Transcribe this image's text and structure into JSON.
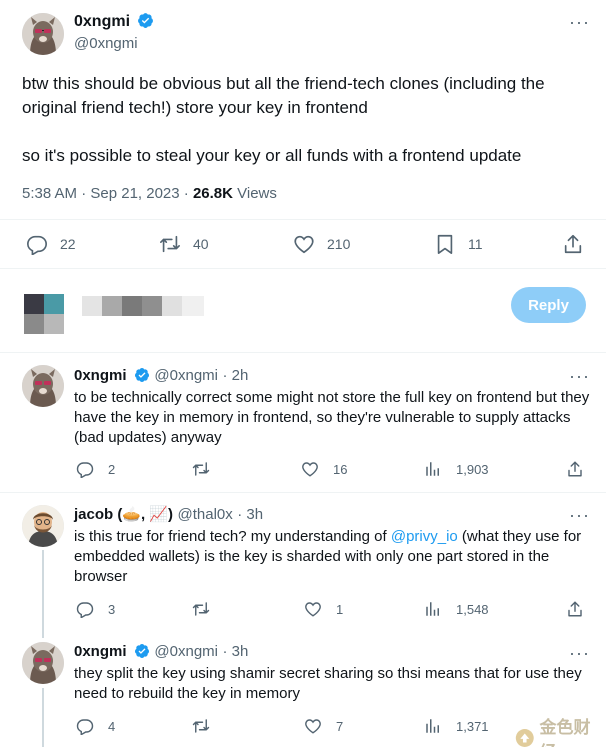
{
  "tweet": {
    "author_name": "0xngmi",
    "author_handle": "@0xngmi",
    "text_line1": "btw this should be obvious but all the friend-tech clones (including the original friend tech!) store your key in frontend",
    "text_line2": "so it's possible to steal your key or all funds with a frontend update",
    "time": "5:38 AM · Sep 21, 2023 · ",
    "views_count": "26.8K",
    "views_label": " Views",
    "replies": "22",
    "retweets": "40",
    "likes": "210",
    "bookmarks": "11"
  },
  "composer": {
    "reply_button": "Reply"
  },
  "replies": [
    {
      "name": "0xngmi",
      "handle": "@0xngmi",
      "time": "· 2h",
      "text": "to be technically correct some might not store the full key on frontend but they have the key in memory in frontend, so they're vulnerable to supply attacks (bad updates) anyway",
      "replies": "2",
      "likes": "16",
      "views": "1,903"
    },
    {
      "name": "jacob (🥧, 📈)",
      "handle": "@thal0x",
      "time": "· 3h",
      "text_before": "is this true for friend tech? my understanding of ",
      "mention": "@privy_io",
      "text_after": " (what they use for embedded wallets) is the key is sharded with only one part stored in the browser",
      "replies": "3",
      "likes": "1",
      "views": "1,548"
    },
    {
      "name": "0xngmi",
      "handle": "@0xngmi",
      "time": "· 3h",
      "text": "they split the key using shamir secret sharing so thsi means that for use they need to rebuild the key in memory",
      "replies": "4",
      "likes": "7",
      "views": "1,371"
    }
  ],
  "watermark": "金色财经",
  "colors": {
    "accent": "#1d9bf0",
    "reply_button": "#8ecdf8",
    "muted": "#536471",
    "text": "#0f1419"
  }
}
